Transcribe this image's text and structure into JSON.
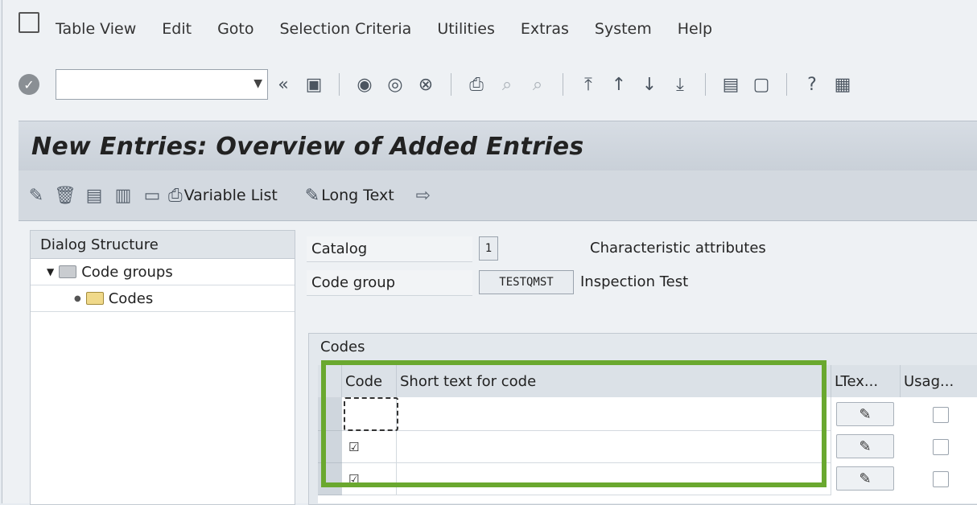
{
  "menubar": {
    "items": [
      "Table View",
      "Edit",
      "Goto",
      "Selection Criteria",
      "Utilities",
      "Extras",
      "System",
      "Help"
    ]
  },
  "toolbar": {
    "command_value": "",
    "back_label": "«"
  },
  "title": "New Entries: Overview of Added Entries",
  "app_toolbar": {
    "variable_list_label": "Variable List",
    "long_text_label": "Long Text"
  },
  "dialog_structure": {
    "header": "Dialog Structure",
    "items": [
      {
        "label": "Code groups"
      },
      {
        "label": "Codes"
      }
    ]
  },
  "header_fields": {
    "catalog_label": "Catalog",
    "catalog_value": "1",
    "catalog_text": "Characteristic attributes",
    "code_group_label": "Code group",
    "code_group_value": "TESTQMST",
    "code_group_text": "Inspection Test"
  },
  "codes_table": {
    "title": "Codes",
    "columns": [
      "Code",
      "Short text for code",
      "LTex...",
      "Usag..."
    ],
    "rows": [
      {
        "code": "",
        "short_text": "",
        "usage_checked": false
      },
      {
        "code": "☑",
        "short_text": "",
        "usage_checked": false
      },
      {
        "code": "☑",
        "short_text": "",
        "usage_checked": false
      }
    ]
  },
  "highlight_color": "#6aa82f"
}
